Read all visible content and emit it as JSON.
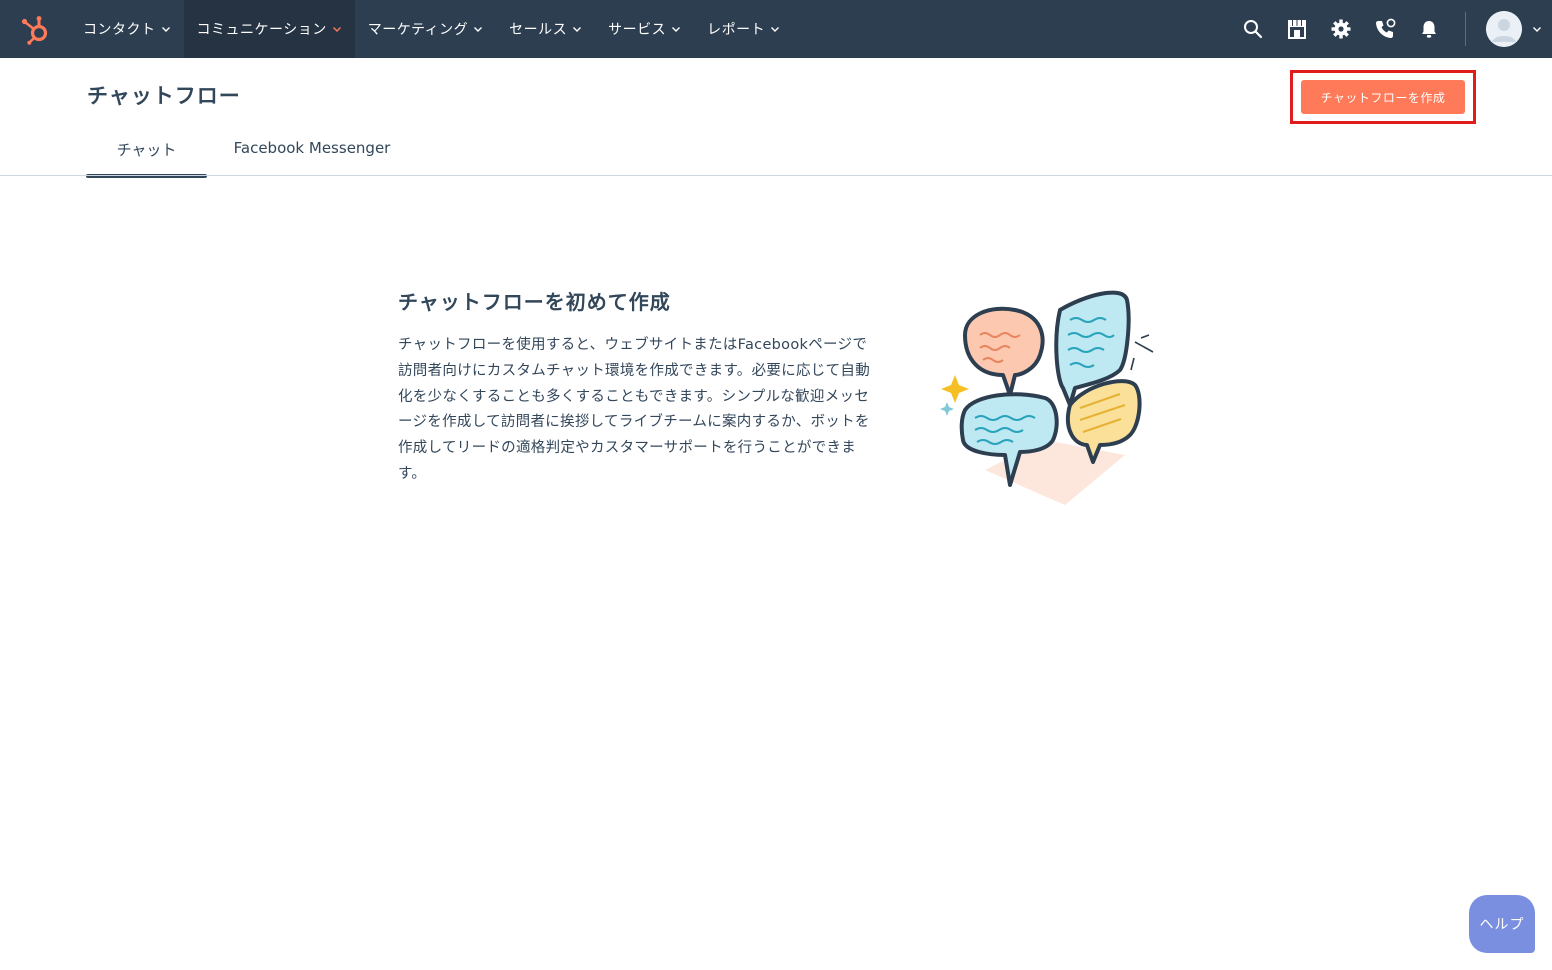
{
  "nav": {
    "logo": "hubspot-logo",
    "items": [
      {
        "label": "コンタクト",
        "active": false
      },
      {
        "label": "コミュニケーション",
        "active": true
      },
      {
        "label": "マーケティング",
        "active": false
      },
      {
        "label": "セールス",
        "active": false
      },
      {
        "label": "サービス",
        "active": false
      },
      {
        "label": "レポート",
        "active": false
      }
    ],
    "icons": [
      "search-icon",
      "marketplace-icon",
      "settings-icon",
      "calling-icon",
      "notifications-icon"
    ]
  },
  "header": {
    "title": "チャットフロー",
    "create_button": "チャットフローを作成",
    "tabs": [
      {
        "label": "チャット",
        "active": true
      },
      {
        "label": "Facebook Messenger",
        "active": false
      }
    ]
  },
  "empty_state": {
    "title": "チャットフローを初めて作成",
    "body_lines": [
      "チャットフローを使用すると、ウェブサイトまたはFacebookページで",
      "訪問者向けにカスタムチャット環境を作成できます。必要に応じて自動",
      "化を少なくすることも多くすることもできます。シンプルな歓迎メッセ",
      "ージを作成して訪問者に挨拶してライブチームに案内するか、ボットを",
      "作成してリードの適格判定やカスタマーサポートを行うことができま",
      "す。"
    ]
  },
  "help": {
    "label": "ヘルプ"
  },
  "colors": {
    "nav_bg": "#2d3e50",
    "accent": "#ff7a59",
    "text": "#33475b",
    "highlight": "#e01c1c",
    "help_bg": "#7b8fe0"
  }
}
